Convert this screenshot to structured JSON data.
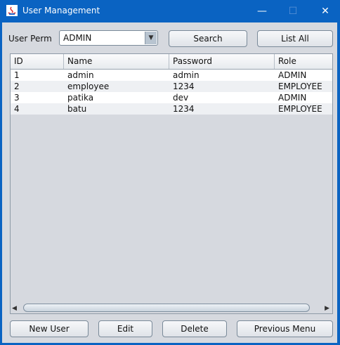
{
  "window": {
    "title": "User Management",
    "minimize_glyph": "—",
    "maximize_glyph": "☐",
    "close_glyph": "✕"
  },
  "filter": {
    "label": "User Perm",
    "selected": "ADMIN",
    "arrow_glyph": "▼"
  },
  "buttons": {
    "search": "Search",
    "list_all": "List All",
    "new_user": "New User",
    "edit": "Edit",
    "delete": "Delete",
    "previous_menu": "Previous Menu"
  },
  "table": {
    "columns": [
      "ID",
      "Name",
      "Password",
      "Role"
    ],
    "rows": [
      [
        "1",
        "admin",
        "admin",
        "ADMIN"
      ],
      [
        "2",
        "employee",
        "1234",
        "EMPLOYEE"
      ],
      [
        "3",
        "patika",
        "dev",
        "ADMIN"
      ],
      [
        "4",
        "batu",
        "1234",
        "EMPLOYEE"
      ]
    ]
  },
  "scrollbar": {
    "left_glyph": "◀",
    "right_glyph": "▶"
  },
  "colors": {
    "titlebar": "#0a63c2",
    "client": "#d6d9df"
  }
}
